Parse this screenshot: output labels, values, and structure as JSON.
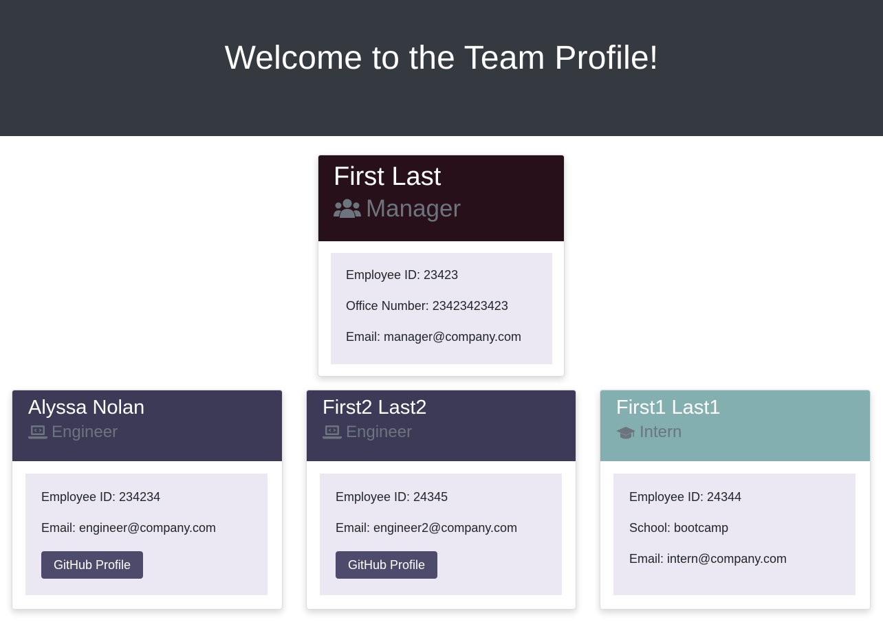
{
  "header": {
    "title": "Welcome to the Team Profile!"
  },
  "colors": {
    "jumbotron_bg": "#343a40",
    "manager_header": "#271019",
    "engineer_header": "#3c3a56",
    "intern_header": "#83afb0",
    "info_panel": "#ebe8f3",
    "button_bg": "#4e4a6b",
    "role_text": "#6c757d"
  },
  "manager": {
    "name": "First Last",
    "role": "Manager",
    "icon": "users-icon",
    "id_line": "Employee ID: 23423",
    "office_line": "Office Number: 23423423423",
    "email_line": "Email: manager@company.com"
  },
  "engineers": [
    {
      "name": "Alyssa Nolan",
      "role": "Engineer",
      "icon": "laptop-code-icon",
      "id_line": "Employee ID: 234234",
      "email_line": "Email: engineer@company.com",
      "github_label": "GitHub Profile"
    },
    {
      "name": "First2 Last2",
      "role": "Engineer",
      "icon": "laptop-code-icon",
      "id_line": "Employee ID: 24345",
      "email_line": "Email: engineer2@company.com",
      "github_label": "GitHub Profile"
    }
  ],
  "intern": {
    "name": "First1 Last1",
    "role": "Intern",
    "icon": "graduation-cap-icon",
    "id_line": "Employee ID: 24344",
    "school_line": "School: bootcamp",
    "email_line": "Email: intern@company.com"
  }
}
